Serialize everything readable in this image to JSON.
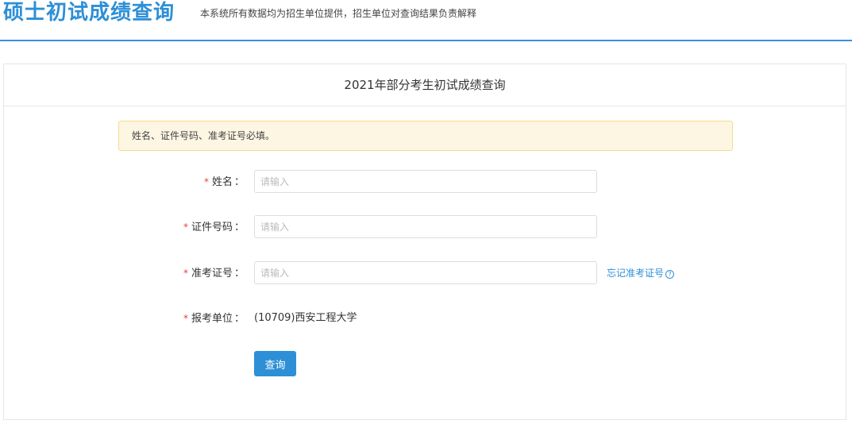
{
  "header": {
    "title": "硕士初试成绩查询",
    "subtitle": "本系统所有数据均为招生单位提供，招生单位对查询结果负责解释"
  },
  "panel": {
    "title": "2021年部分考生初试成绩查询"
  },
  "notice": {
    "text": "姓名、证件号码、准考证号必填。"
  },
  "form": {
    "required_mark": "*",
    "colon": "：",
    "name": {
      "label": "姓名",
      "placeholder": "请输入",
      "value": ""
    },
    "id_number": {
      "label": "证件号码",
      "placeholder": "请输入",
      "value": ""
    },
    "exam_number": {
      "label": "准考证号",
      "placeholder": "请输入",
      "value": ""
    },
    "forgot_link": "忘记准考证号",
    "help_icon_glyph": "?",
    "institution": {
      "label": "报考单位",
      "value": "(10709)西安工程大学"
    },
    "submit_label": "查询"
  },
  "colors": {
    "accent": "#2d8fd6",
    "required": "#e64340",
    "notice_bg": "#fdf6e3",
    "notice_border": "#f5dc8a"
  }
}
